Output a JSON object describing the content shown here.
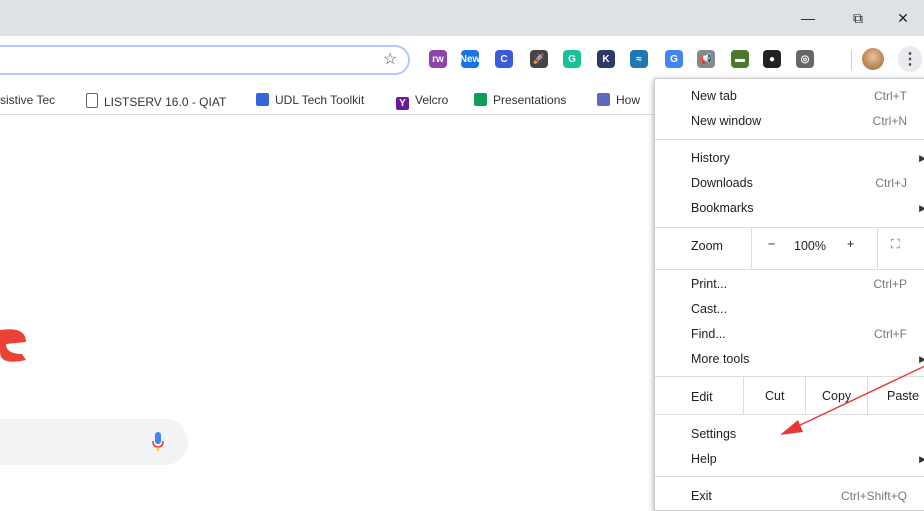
{
  "window": {
    "minimize": "—",
    "restore": "⧉",
    "close": "✕"
  },
  "toolbar": {
    "star_icon": "☆",
    "menu_icon": "⋮"
  },
  "extensions": [
    {
      "name": "puzzle",
      "label": "rw",
      "color": "#8e44ad"
    },
    {
      "name": "new-badge",
      "label": "New",
      "color": "#1a73e8"
    },
    {
      "name": "c-ext",
      "label": "C",
      "color": "#3b5bdb"
    },
    {
      "name": "rocket",
      "label": "🚀",
      "color": "#444"
    },
    {
      "name": "grammarly",
      "label": "G",
      "color": "#15c39a"
    },
    {
      "name": "k-ext",
      "label": "K",
      "color": "#2b3a67"
    },
    {
      "name": "wave",
      "label": "≈",
      "color": "#1f78b4"
    },
    {
      "name": "translate",
      "label": "G",
      "color": "#4285f4"
    },
    {
      "name": "megaphone",
      "label": "📢",
      "color": "#888"
    },
    {
      "name": "monitor",
      "label": "▬",
      "color": "#4a7a2e"
    },
    {
      "name": "color-circle",
      "label": "●",
      "color": "#222"
    },
    {
      "name": "spiral",
      "label": "◎",
      "color": "#666"
    }
  ],
  "bookmarks": [
    {
      "label": "sistive Tec",
      "color": "#9aa0a6"
    },
    {
      "label": "LISTSERV 16.0 - QIAT",
      "color": "#ffffff"
    },
    {
      "label": "UDL Tech Toolkit",
      "color": "#3367d6"
    },
    {
      "label": "Velcro",
      "color": "#6a1b9a"
    },
    {
      "label": "Presentations",
      "color": "#0f9d58"
    },
    {
      "label": "How",
      "color": "#5c6bc0"
    }
  ],
  "menu": {
    "new_tab": "New tab",
    "new_tab_sc": "Ctrl+T",
    "new_window": "New window",
    "new_window_sc": "Ctrl+N",
    "history": "History",
    "downloads": "Downloads",
    "downloads_sc": "Ctrl+J",
    "bookmarks": "Bookmarks",
    "zoom": "Zoom",
    "zoom_minus": "−",
    "zoom_value": "100%",
    "zoom_plus": "+",
    "fullscreen": "⛶",
    "print": "Print...",
    "print_sc": "Ctrl+P",
    "cast": "Cast...",
    "find": "Find...",
    "find_sc": "Ctrl+F",
    "more_tools": "More tools",
    "edit": "Edit",
    "cut": "Cut",
    "copy": "Copy",
    "paste": "Paste",
    "settings": "Settings",
    "help": "Help",
    "exit": "Exit",
    "exit_sc": "Ctrl+Shift+Q",
    "submenu_arrow": "▶"
  }
}
